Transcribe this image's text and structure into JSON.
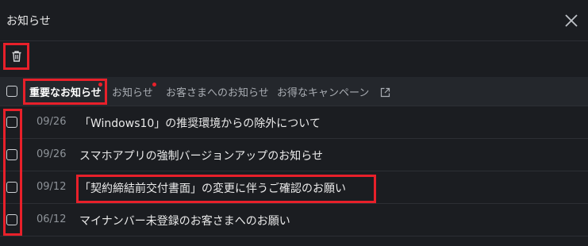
{
  "header": {
    "title": "お知らせ",
    "close_icon": "close-icon"
  },
  "toolbar": {
    "delete_icon": "trash-icon"
  },
  "tabs": [
    {
      "label": "重要なお知らせ",
      "active": true,
      "has_dot": true
    },
    {
      "label": "お知らせ",
      "active": false,
      "has_dot": true
    },
    {
      "label": "お客さまへのお知らせ",
      "active": false,
      "has_dot": false
    },
    {
      "label": "お得なキャンペーン",
      "active": false,
      "has_dot": false,
      "icon": "external-link-icon"
    }
  ],
  "notices": [
    {
      "date": "09/26",
      "title": "「Windows10」の推奨環境からの除外について"
    },
    {
      "date": "09/26",
      "title": "スマホアプリの強制バージョンアップのお知らせ"
    },
    {
      "date": "09/12",
      "title": "「契約締結前交付書面」の変更に伴うご確認のお願い"
    },
    {
      "date": "06/12",
      "title": "マイナンバー未登録のお客さまへのお願い"
    }
  ],
  "colors": {
    "background": "#1b1d21",
    "tab_bar": "#24272c",
    "accent_red": "#e8202a",
    "text": "#eaeaea",
    "muted": "#8e9399"
  }
}
